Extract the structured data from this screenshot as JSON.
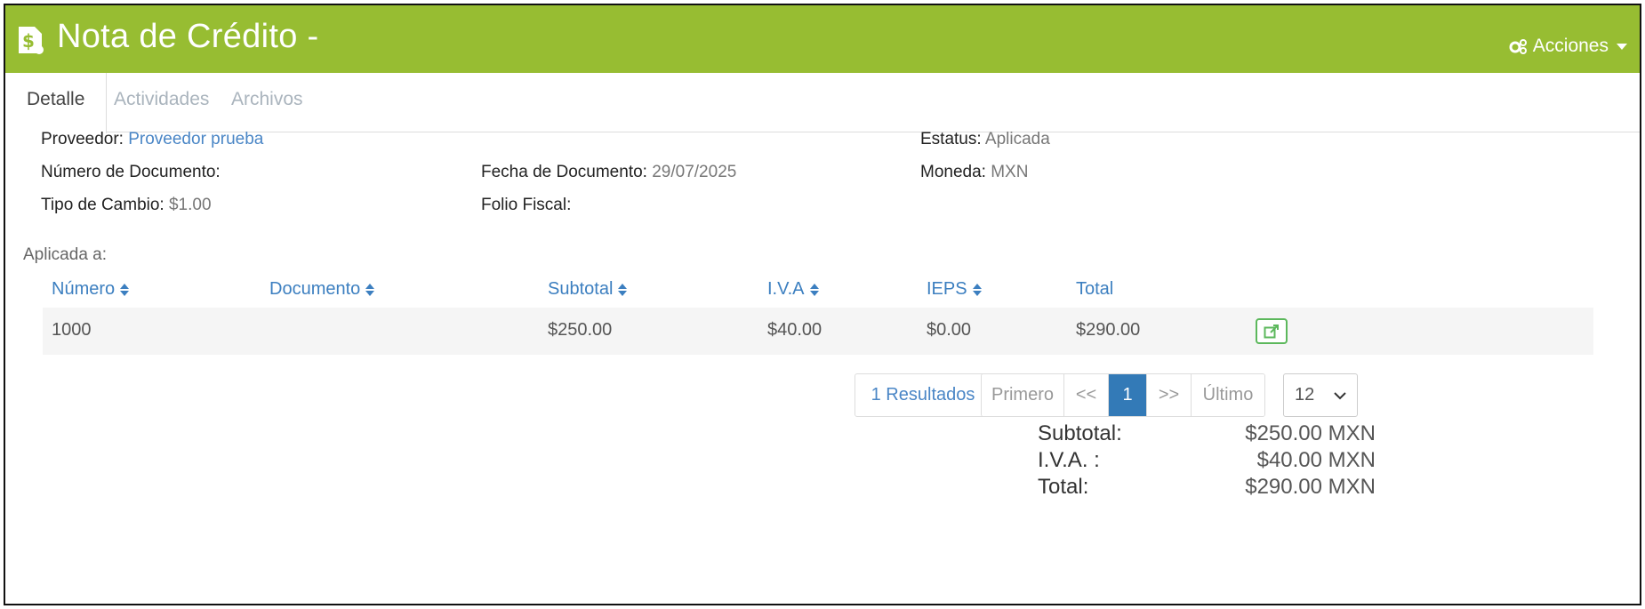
{
  "header": {
    "title": "Nota de Crédito -",
    "actions_label": "Acciones",
    "logo_icon": "dollar-document-icon",
    "background": "#97bd32"
  },
  "tabs": [
    {
      "label": "Detalle",
      "active": true
    },
    {
      "label": "Actividades",
      "active": false
    },
    {
      "label": "Archivos",
      "active": false
    }
  ],
  "details": {
    "proveedor_label": "Proveedor:",
    "proveedor_value": "Proveedor prueba",
    "estatus_label": "Estatus:",
    "estatus_value": "Aplicada",
    "numero_doc_label": "Número de Documento:",
    "numero_doc_value": "",
    "fecha_doc_label": "Fecha de Documento:",
    "fecha_doc_value": "29/07/2025",
    "moneda_label": "Moneda:",
    "moneda_value": "MXN",
    "tipo_cambio_label": "Tipo de Cambio:",
    "tipo_cambio_value": "$1.00",
    "folio_fiscal_label": "Folio Fiscal:",
    "folio_fiscal_value": ""
  },
  "applied_label": "Aplicada a:",
  "table": {
    "headers": [
      "Número",
      "Documento",
      "Subtotal",
      "I.V.A",
      "IEPS",
      "Total"
    ],
    "rows": [
      {
        "numero": "1000",
        "documento": "",
        "subtotal": "$250.00",
        "iva": "$40.00",
        "ieps": "$0.00",
        "total": "$290.00"
      }
    ]
  },
  "pagination": {
    "results": "1 Resultados",
    "first": "Primero",
    "prev": "<<",
    "current": "1",
    "next": ">>",
    "last": "Último",
    "page_size": "12"
  },
  "totals": {
    "subtotal_label": "Subtotal:",
    "subtotal_value": "$250.00 MXN",
    "iva_label": "I.V.A. :",
    "iva_value": "$40.00 MXN",
    "total_label": "Total:",
    "total_value": "$290.00 MXN"
  }
}
